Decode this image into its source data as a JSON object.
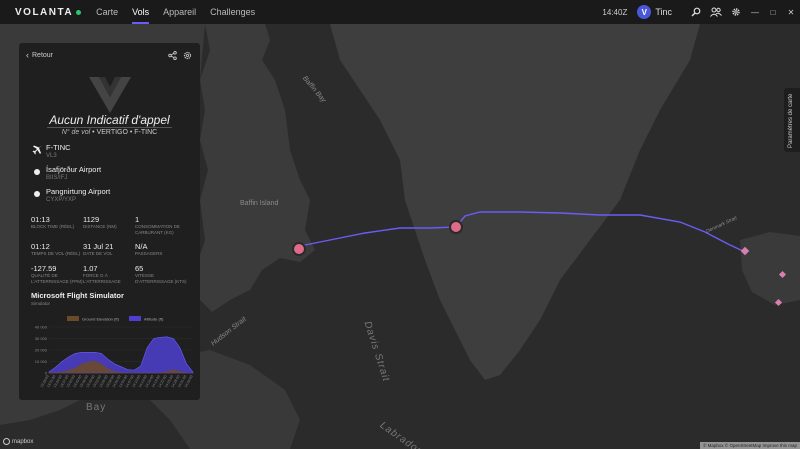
{
  "app": {
    "name": "VOLANTA"
  },
  "nav": [
    {
      "label": "Carte",
      "active": false
    },
    {
      "label": "Vols",
      "active": true
    },
    {
      "label": "Appareil",
      "active": false
    },
    {
      "label": "Challenges",
      "active": false
    }
  ],
  "topbar": {
    "clock": "14:40Z",
    "user_initial": "V",
    "user_name": "Tinc",
    "icons": [
      "search-icon",
      "users-icon",
      "gear-icon"
    ],
    "window_controls": [
      "—",
      "□",
      "✕"
    ]
  },
  "map": {
    "labels": {
      "baffin_bay": "Baffin Bay",
      "baffin_island": "Baffin Island",
      "davis_strait": "Davis Strait",
      "hudson_strait": "Hudson Strait",
      "labrador_sea": "Labrador Sea",
      "bay": "Bay",
      "denmark_strait": "Denmark Strait"
    },
    "params_label": "Paramètres de carte",
    "mapbox": "mapbox",
    "attribution": "© Mapbox © OpenStreetMap Improve this map"
  },
  "panel": {
    "back_label": "Retour",
    "callsign": "Aucun Indicatif d'appel",
    "flight_prefix": "N° de vol",
    "flight_number": "VERTIGO",
    "registration": "F-TINC",
    "aircraft": {
      "title": "F-TINC",
      "sub": "VL3"
    },
    "departure": {
      "title": "Ísafjörður Airport",
      "sub": "BIIS/IFJ"
    },
    "arrival": {
      "title": "Pangnirtung Airport",
      "sub": "CYXP/YXP"
    },
    "stats": [
      {
        "value": "01:13",
        "label": "Block time (réel)"
      },
      {
        "value": "1129",
        "label": "Distance (NM)"
      },
      {
        "value": "1",
        "label": "Consommation de carburant (kg)"
      },
      {
        "value": "01:12",
        "label": "Temps de vol (réel)"
      },
      {
        "value": "31 Jul 21",
        "label": "Date de vol"
      },
      {
        "value": "N/A",
        "label": "Passagers"
      },
      {
        "value": "-127.59",
        "label": "Qualité de l'atterrissage (FPM)"
      },
      {
        "value": "1.07",
        "label": "Force G à l'atterrissage"
      },
      {
        "value": "65",
        "label": "Vitesse d'atterrissage (KTS)"
      }
    ],
    "simulator": "Microsoft Flight Simulator",
    "simulator_label": "Simulator"
  },
  "chart_data": {
    "type": "area",
    "series": [
      {
        "name": "Ground Elevation (ft)",
        "color": "#6b4a2a",
        "values": [
          600,
          600,
          1200,
          2500,
          4500,
          8000,
          10000,
          10500,
          8000,
          4000,
          1500,
          800,
          400,
          300,
          300,
          300,
          300,
          500,
          1500,
          3000,
          1500,
          400,
          300
        ]
      },
      {
        "name": "Altitude (ft)",
        "color": "#4f3fd0",
        "values": [
          1000,
          5000,
          10000,
          14000,
          17000,
          18000,
          18000,
          18000,
          17000,
          12000,
          8000,
          5500,
          3000,
          2500,
          6000,
          22000,
          30000,
          31000,
          31500,
          30000,
          22000,
          8000,
          800
        ]
      }
    ],
    "ylabel": "",
    "yticks": [
      0,
      10000,
      20000,
      30000,
      40000
    ],
    "ytick_labels": [
      "0",
      "10 000",
      "20 000",
      "30 000",
      "40 000"
    ],
    "ylim": [
      0,
      40000
    ],
    "x_labels": [
      "13:28:00",
      "13:31:00",
      "13:34:00",
      "13:37:00",
      "13:40:00",
      "13:43:00",
      "13:46:00",
      "13:49:00",
      "13:52:00",
      "13:55:00",
      "13:58:00",
      "14:01:00",
      "14:04:00",
      "14:07:00",
      "14:10:00",
      "14:13:00",
      "14:16:00",
      "14:19:00",
      "14:22:00",
      "14:25:00",
      "14:28:00",
      "14:31:00",
      "14:34:00"
    ],
    "legend": "top"
  }
}
